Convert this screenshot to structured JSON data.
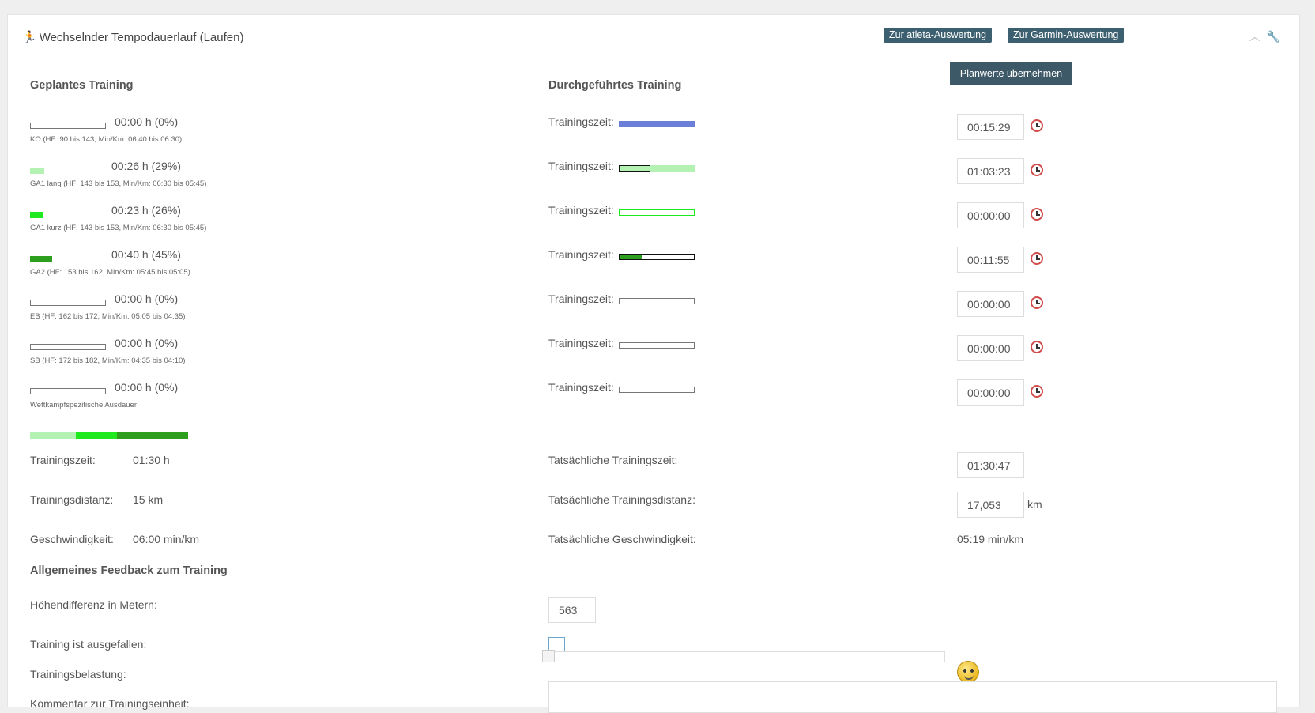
{
  "header": {
    "title": "Wechselnder Tempodauerlauf (Laufen)",
    "atleta_btn": "Zur atleta-Auswertung",
    "garmin_btn": "Zur Garmin-Auswertung",
    "collapse_icon": "chevron-up-icon",
    "settings_icon": "wrench-icon"
  },
  "planned": {
    "title": "Geplantes Training",
    "zones": [
      {
        "time": "00:00 h (0%)",
        "desc": "KO (HF: 90 bis 143, Min/Km: 06:40 bis 06:30)",
        "fraction": 0,
        "color": "#ffffff"
      },
      {
        "time": "00:26 h (29%)",
        "desc": "GA1 lang (HF: 143 bis 153, Min/Km: 06:30 bis 05:45)",
        "fraction": 0.29,
        "color": "#b3f2b3"
      },
      {
        "time": "00:23 h (26%)",
        "desc": "GA1 kurz (HF: 143 bis 153, Min/Km: 06:30 bis 05:45)",
        "fraction": 0.26,
        "color": "#1ee81e"
      },
      {
        "time": "00:40 h (45%)",
        "desc": "GA2 (HF: 153 bis 162, Min/Km: 05:45 bis 05:05)",
        "fraction": 0.45,
        "color": "#2e9e1e"
      },
      {
        "time": "00:00 h (0%)",
        "desc": "EB (HF: 162 bis 172, Min/Km: 05:05 bis 04:35)",
        "fraction": 0,
        "color": "#ffffff"
      },
      {
        "time": "00:00 h (0%)",
        "desc": "SB (HF: 172 bis 182, Min/Km: 04:35 bis 04:10)",
        "fraction": 0,
        "color": "#ffffff"
      },
      {
        "time": "00:00 h (0%)",
        "desc": "Wettkampfspezifische Ausdauer",
        "fraction": 0,
        "color": "#ffffff"
      }
    ],
    "stats": {
      "time_label": "Trainingszeit:",
      "time_value": "01:30 h",
      "dist_label": "Trainingsdistanz:",
      "dist_value": "15 km",
      "speed_label": "Geschwindigkeit:",
      "speed_value": "06:00 min/km"
    }
  },
  "done": {
    "title": "Durchgeführtes Training",
    "take_over_btn": "Planwerte übernehmen",
    "row_label": "Trainingszeit:",
    "rows": [
      {
        "value": "00:15:29",
        "fill": 1.0,
        "fill_color": "#6b7fd8",
        "overflow_color": null
      },
      {
        "value": "01:03:23",
        "fill": 0.41,
        "fill_color": "#b3f2b3",
        "overflow_color": "#b3f2b3"
      },
      {
        "value": "00:00:00",
        "fill": 0,
        "fill_color": "#1ee81e",
        "overflow_color": null
      },
      {
        "value": "00:11:55",
        "fill": 0.3,
        "fill_color": "#2e9e1e",
        "overflow_color": null
      },
      {
        "value": "00:00:00",
        "fill": 0,
        "fill_color": "#ffffff",
        "overflow_color": null
      },
      {
        "value": "00:00:00",
        "fill": 0,
        "fill_color": "#ffffff",
        "overflow_color": null
      },
      {
        "value": "00:00:00",
        "fill": 0,
        "fill_color": "#ffffff",
        "overflow_color": null
      }
    ],
    "clock_icon": "stopwatch-icon",
    "stats": {
      "time_label": "Tatsächliche Trainingszeit:",
      "time_value": "01:30:47",
      "dist_label": "Tatsächliche Trainingsdistanz:",
      "dist_value": "17,053",
      "dist_unit": "km",
      "speed_label": "Tatsächliche Geschwindigkeit:",
      "speed_value": "05:19 min/km"
    }
  },
  "feedback": {
    "title": "Allgemeines Feedback zum Training",
    "height_label": "Höhendifferenz in Metern:",
    "height_value": "563",
    "cancel_label": "Training ist ausgefallen:",
    "load_label": "Trainingsbelastung:",
    "load_icon": "smiley-icon",
    "comment_label": "Kommentar zur Trainingseinheit:"
  }
}
